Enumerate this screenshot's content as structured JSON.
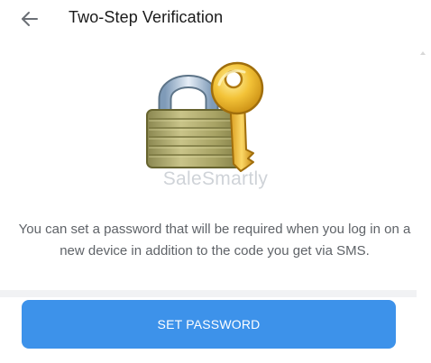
{
  "header": {
    "back_icon": "arrow-left-icon",
    "title": "Two-Step Verification"
  },
  "illustration": {
    "icon": "padlock-with-key-icon",
    "watermark": "SaleSmartly"
  },
  "content": {
    "description": "You can set a password that will be required when you log in on a new device in addition to the code you get via SMS."
  },
  "actions": {
    "set_password_label": "SET PASSWORD"
  },
  "colors": {
    "primary": "#3d92ea",
    "title": "#1a1a1a",
    "body_text": "#5f6368"
  }
}
